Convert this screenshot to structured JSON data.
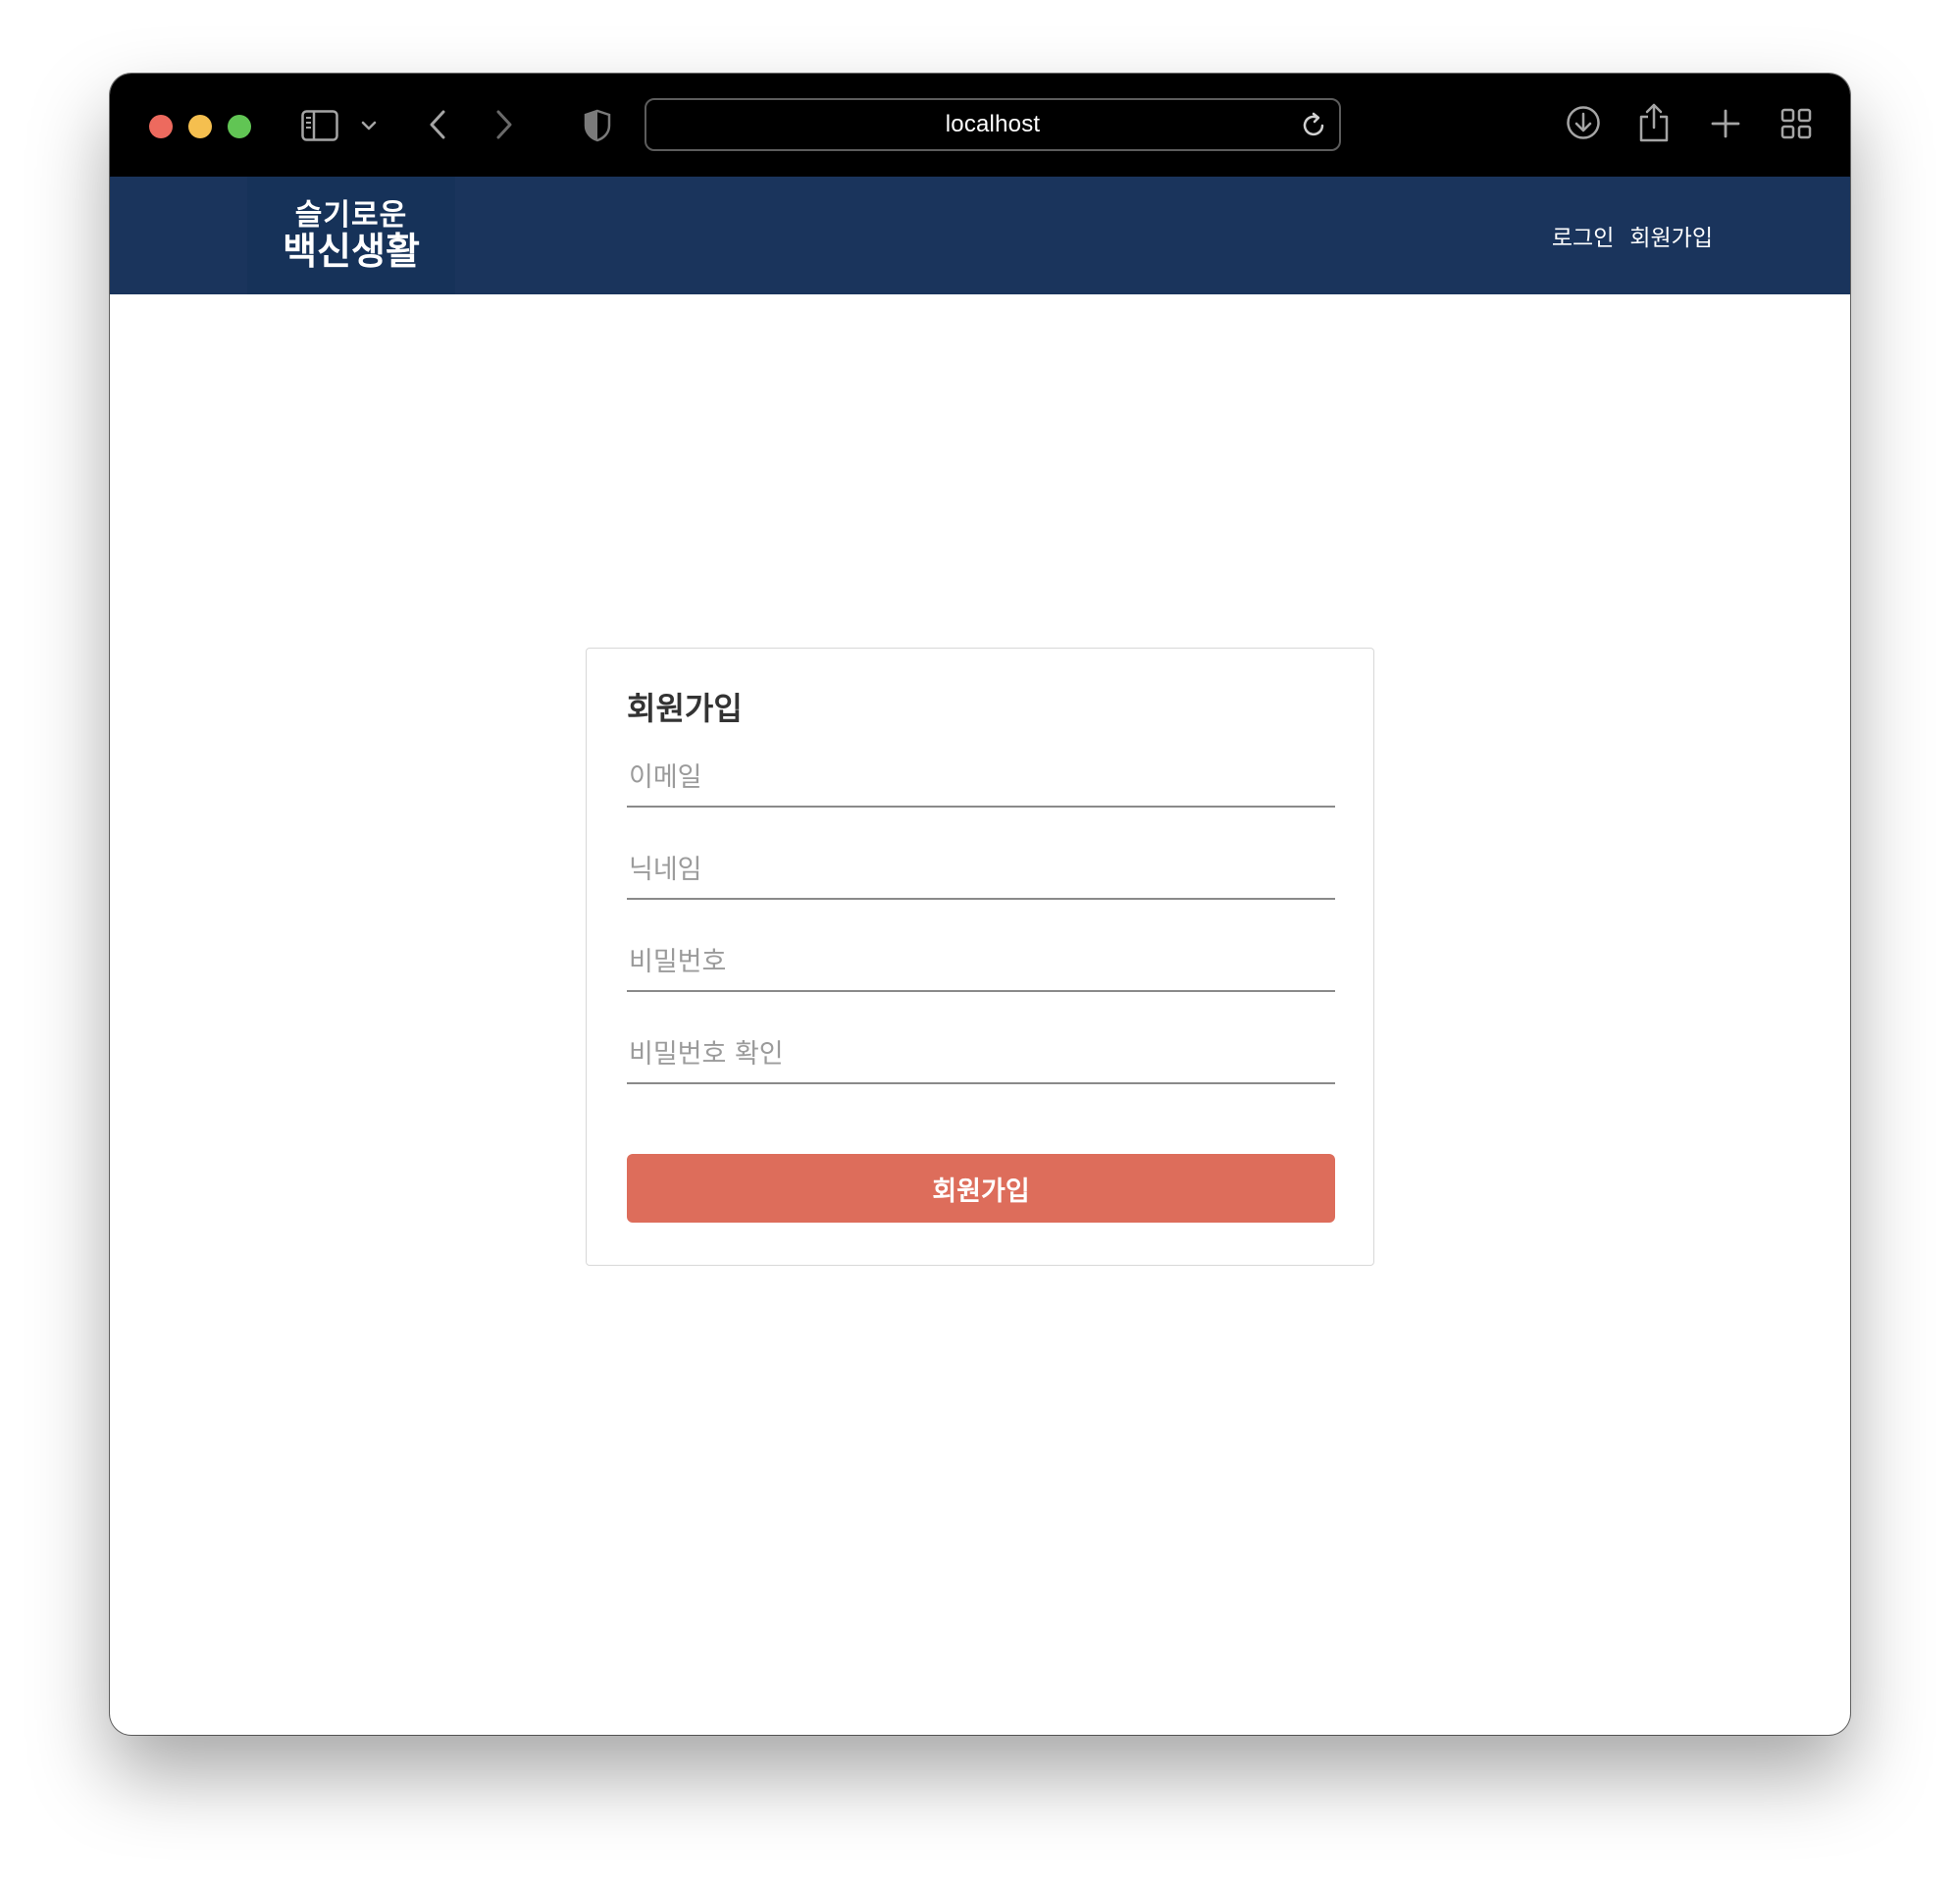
{
  "browser": {
    "url": "localhost",
    "icons": {
      "sidebar": "sidebar-icon",
      "chevron": "chevron-down-icon",
      "back": "back-icon",
      "forward": "forward-icon",
      "shield": "shield-icon",
      "reload": "reload-icon",
      "download": "download-icon",
      "share": "share-icon",
      "new_tab": "plus-icon",
      "tabs": "tab-overview-icon"
    }
  },
  "header": {
    "logo_line1": "슬기로운",
    "logo_line2": "백신생활",
    "nav": {
      "login": "로그인",
      "signup": "회원가입"
    },
    "background_color": "#1a345c"
  },
  "signup_form": {
    "title": "회원가입",
    "email_placeholder": "이메일",
    "email_value": "",
    "nickname_placeholder": "닉네임",
    "nickname_value": "",
    "password_placeholder": "비밀번호",
    "password_value": "",
    "password_confirm_placeholder": "비밀번호 확인",
    "password_confirm_value": "",
    "submit_label": "회원가입",
    "submit_color": "#dd6d5b"
  }
}
